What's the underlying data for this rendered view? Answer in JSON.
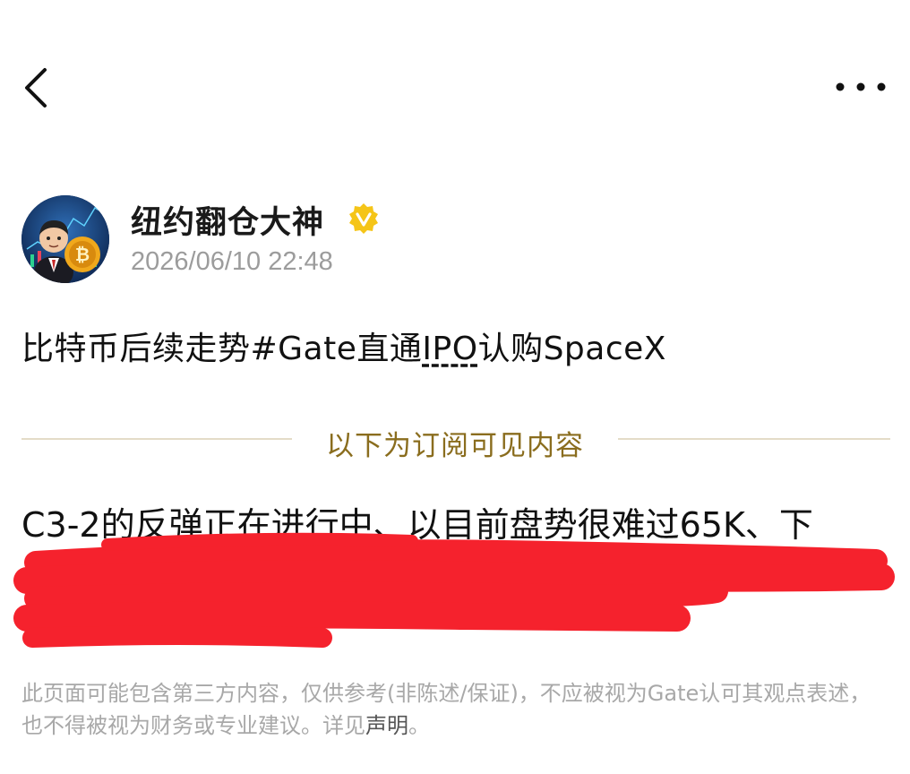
{
  "nav": {
    "back_icon": "chevron-left-icon",
    "more_icon": "more-horizontal-icon"
  },
  "author": {
    "name": "纽约翻仓大神",
    "verified_icon": "verified-badge-icon",
    "verified_color": "#f5c518",
    "timestamp": "2026/06/10 22:48"
  },
  "post": {
    "title_prefix": "比特币后续走势#Gate直通",
    "title_ipo": "IPO",
    "title_suffix": "认购SpaceX",
    "subscriber_divider": "以下为订阅可见内容",
    "content_lines": [
      "C3-2的反弹正在进行中、以目前盘势很难过65K、下",
      "",
      ""
    ],
    "redaction_color": "#f5222d"
  },
  "disclaimer": {
    "text": "此页面可能包含第三方内容，仅供参考(非陈述/保证)，不应被视为Gate认可其观点表述，也不得被视为财务或专业建议。详见",
    "link": "声明",
    "end": "。"
  }
}
